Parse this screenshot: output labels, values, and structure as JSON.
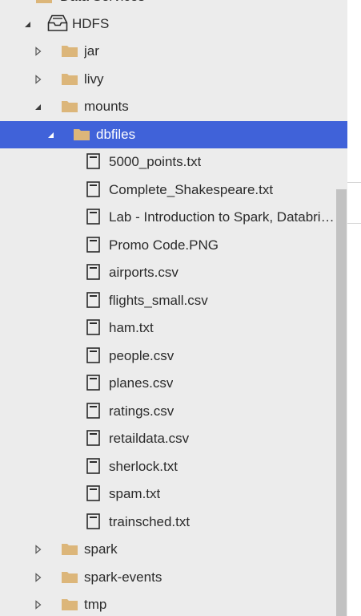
{
  "tree": {
    "data_services_label": "Data Services",
    "hdfs_label": "HDFS",
    "folders": {
      "jar": "jar",
      "livy": "livy",
      "mounts": "mounts",
      "dbfiles": "dbfiles",
      "spark": "spark",
      "spark_events": "spark-events",
      "tmp": "tmp"
    },
    "files": [
      "5000_points.txt",
      "Complete_Shakespeare.txt",
      "Lab - Introduction to Spark, Databricks.ipynb",
      "Promo Code.PNG",
      "airports.csv",
      "flights_small.csv",
      "ham.txt",
      "people.csv",
      "planes.csv",
      "ratings.csv",
      "retaildata.csv",
      "sherlock.txt",
      "spam.txt",
      "trainsched.txt"
    ]
  },
  "colors": {
    "panel_bg": "#ececec",
    "selected_bg": "#4062d9",
    "folder": "#dcb67a",
    "text": "#2b2b2b",
    "scrollbar": "#c2c2c2"
  },
  "icons": {
    "folder": "folder-icon",
    "file": "file-icon",
    "server": "hdfs-server-icon",
    "expanded": "chevron-expanded-icon",
    "collapsed": "chevron-collapsed-icon"
  }
}
